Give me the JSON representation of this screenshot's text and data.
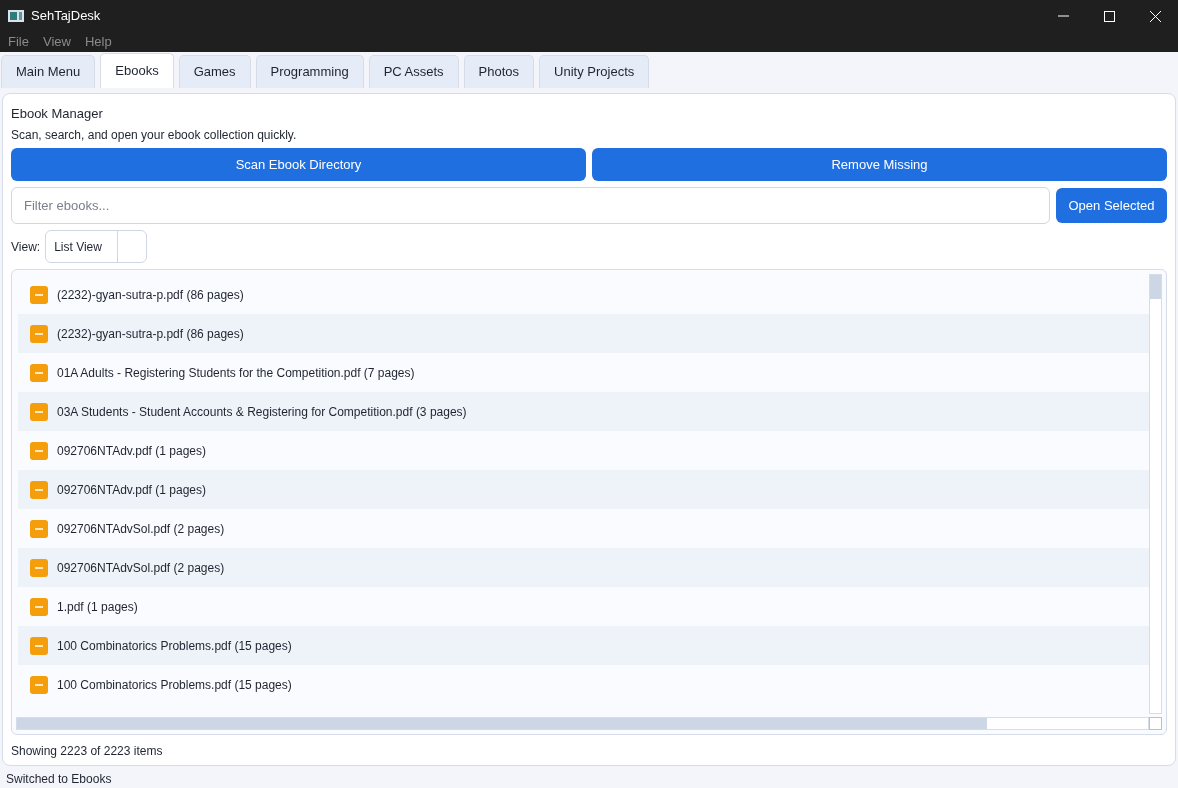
{
  "window": {
    "title": "SehTajDesk"
  },
  "menu": [
    "File",
    "View",
    "Help"
  ],
  "tabs": [
    {
      "label": "Main Menu",
      "selected": false
    },
    {
      "label": "Ebooks",
      "selected": true
    },
    {
      "label": "Games",
      "selected": false
    },
    {
      "label": "Programming",
      "selected": false
    },
    {
      "label": "PC Assets",
      "selected": false
    },
    {
      "label": "Photos",
      "selected": false
    },
    {
      "label": "Unity Projects",
      "selected": false
    }
  ],
  "panel": {
    "title": "Ebook Manager",
    "subtitle": "Scan, search, and open your ebook collection quickly.",
    "buttons": [
      "Scan Ebook Directory",
      "Remove Missing"
    ],
    "filter": {
      "placeholder": "Filter ebooks..."
    },
    "open_button": "Open Selected",
    "view_label": "View:",
    "view_value": "List View",
    "items": [
      {
        "name": "(2232)-gyan-sutra-p.pdf (86 pages)"
      },
      {
        "name": "(2232)-gyan-sutra-p.pdf (86 pages)"
      },
      {
        "name": "01A Adults - Registering Students for the Competition.pdf (7 pages)"
      },
      {
        "name": "03A Students - Student Accounts & Registering for Competition.pdf (3 pages)"
      },
      {
        "name": "092706NTAdv.pdf (1 pages)"
      },
      {
        "name": "092706NTAdv.pdf (1 pages)"
      },
      {
        "name": "092706NTAdvSol.pdf (2 pages)"
      },
      {
        "name": "092706NTAdvSol.pdf (2 pages)"
      },
      {
        "name": "1.pdf (1 pages)"
      },
      {
        "name": "100 Combinatorics Problems.pdf (15 pages)"
      },
      {
        "name": "100 Combinatorics Problems.pdf (15 pages)"
      }
    ],
    "count": "Showing 2223 of 2223 items"
  },
  "status_bar": "Switched to Ebooks"
}
